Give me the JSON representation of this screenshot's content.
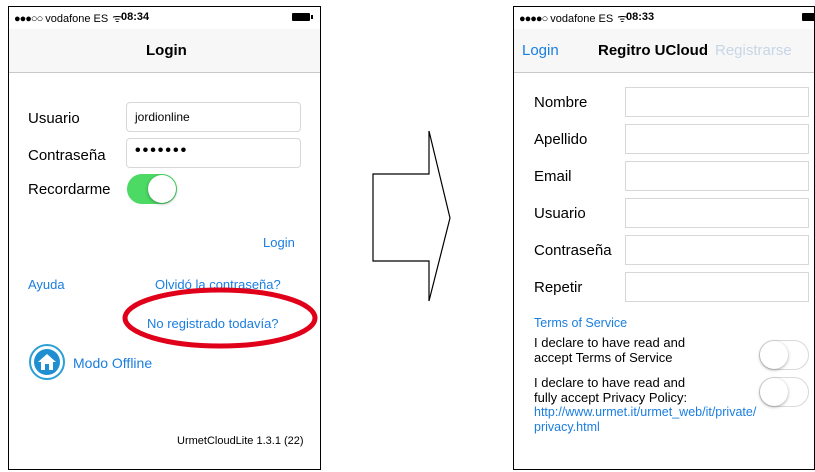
{
  "left_screen": {
    "status": {
      "dots": "●●●○○",
      "carrier": "vodafone ES",
      "wifi": "ᯤ",
      "time": "08:34"
    },
    "nav_title": "Login",
    "form": {
      "user_label": "Usuario",
      "user_value": "jordionline",
      "password_label": "Contraseña",
      "password_value": "•••••••",
      "remember_label": "Recordarme",
      "remember_on": true
    },
    "login_link": "Login",
    "help_link": "Ayuda",
    "forgot_link": "Olvidó la contraseña?",
    "not_registered_link": "No registrado todavía?",
    "offline_label": "Modo Offline",
    "version": "UrmetCloudLite 1.3.1 (22)"
  },
  "right_screen": {
    "status": {
      "dots": "●●●●○",
      "carrier": "vodafone ES",
      "wifi": "ᯤ",
      "time": "08:33"
    },
    "nav_back": "Login",
    "nav_title": "Regitro UCloud",
    "nav_action": "Registrarse",
    "fields": [
      {
        "label": "Nombre",
        "value": ""
      },
      {
        "label": "Apellido",
        "value": ""
      },
      {
        "label": "Email",
        "value": ""
      },
      {
        "label": "Usuario",
        "value": ""
      },
      {
        "label": "Contraseña",
        "value": ""
      },
      {
        "label": "Repetir",
        "value": ""
      }
    ],
    "terms_link": "Terms of Service",
    "declare_terms_line1": "I declare to have read and",
    "declare_terms_line2": "accept Terms of Service",
    "declare_privacy_line1": "I declare to have read and",
    "declare_privacy_line2": "fully accept Privacy Policy:",
    "privacy_url_line1": "http://www.urmet.it/urmet_web/it/private/",
    "privacy_url_line2": "privacy.html"
  },
  "colors": {
    "link": "#1a7ee0",
    "switch_on": "#4cd964",
    "highlight": "#e1001a"
  }
}
